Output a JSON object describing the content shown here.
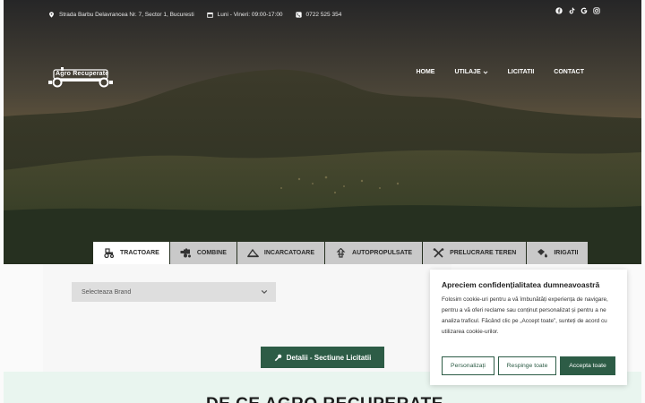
{
  "topbar": {
    "address": "Strada Barbu Delavrancea Nr. 7, Sector 1, Bucuresti",
    "hours": "Luni - Vineri: 09:00-17:00",
    "phone": "0722 525 354",
    "social_icons": [
      "facebook-icon",
      "tiktok-icon",
      "google-icon",
      "instagram-icon"
    ]
  },
  "logo": {
    "text": "Agro Recuperate"
  },
  "nav": {
    "home": "HOME",
    "utilaje": "UTILAJE",
    "licitatii": "LICITATII",
    "contact": "CONTACT"
  },
  "tabs": [
    {
      "label": "TRACTOARE",
      "icon": "tractor-icon",
      "active": true
    },
    {
      "label": "COMBINE",
      "icon": "combine-icon",
      "active": false
    },
    {
      "label": "INCARCATOARE",
      "icon": "loader-icon",
      "active": false
    },
    {
      "label": "AUTOPROPULSATE",
      "icon": "self-propelled-icon",
      "active": false
    },
    {
      "label": "PRELUCRARE TEREN",
      "icon": "soil-tool-icon",
      "active": false
    },
    {
      "label": "IRIGATII",
      "icon": "irrigation-icon",
      "active": false
    }
  ],
  "search": {
    "brand_select": "Selecteaza Brand",
    "details_button": "Detalii - Sectiune Licitatii"
  },
  "headline": "DE CE AGRO RECUPERATE",
  "cookie": {
    "title": "Apreciem confidențialitatea dumneavoastră",
    "text": "Folosim cookie-uri pentru a vă îmbunătăți experiența de navigare, pentru a vă oferi reclame sau conținut personalizat și pentru a ne analiza traficul. Făcând clic pe „Accept toate”, sunteți de acord cu utilizarea cookie-urilor.",
    "customize": "Personalizați",
    "reject": "Respinge toate",
    "accept": "Accepta toate"
  },
  "colors": {
    "brand_green": "#2d5c46",
    "tab_inactive": "#c9c9c9",
    "band": "#e9f5ef"
  }
}
